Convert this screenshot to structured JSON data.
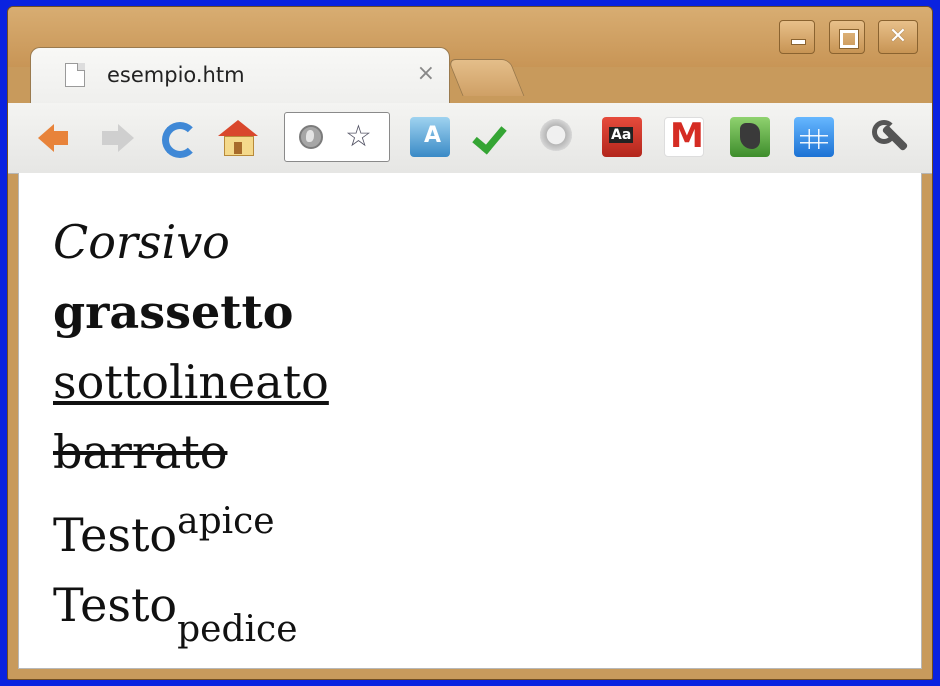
{
  "window": {
    "controls": {
      "minimize_icon": "minimize-icon",
      "maximize_icon": "maximize-icon",
      "close_glyph": "✕"
    }
  },
  "tab": {
    "title": "esempio.htm",
    "close_glyph": "×"
  },
  "toolbar": {
    "back_icon": "back-arrow-icon",
    "forward_icon": "forward-arrow-icon",
    "reload_icon": "reload-icon",
    "home_icon": "home-icon",
    "globe_icon": "globe-icon",
    "star_glyph": "☆",
    "extensions": [
      "google-translate-icon",
      "checkmark-icon",
      "adblock-stop-icon",
      "dictionary-icon",
      "gmail-icon",
      "evernote-icon",
      "calendar-icon"
    ],
    "wrench_icon": "wrench-icon"
  },
  "content": {
    "italic": "Corsivo",
    "bold": "grassetto",
    "underline": "sottolineato",
    "strikethrough": "barrato",
    "sup_base": "Testo",
    "sup_text": "apice",
    "sub_base": "Testo",
    "sub_text": "pedice"
  },
  "colors": {
    "desktop": "#0a22e0",
    "frame": "#c89a5c"
  }
}
